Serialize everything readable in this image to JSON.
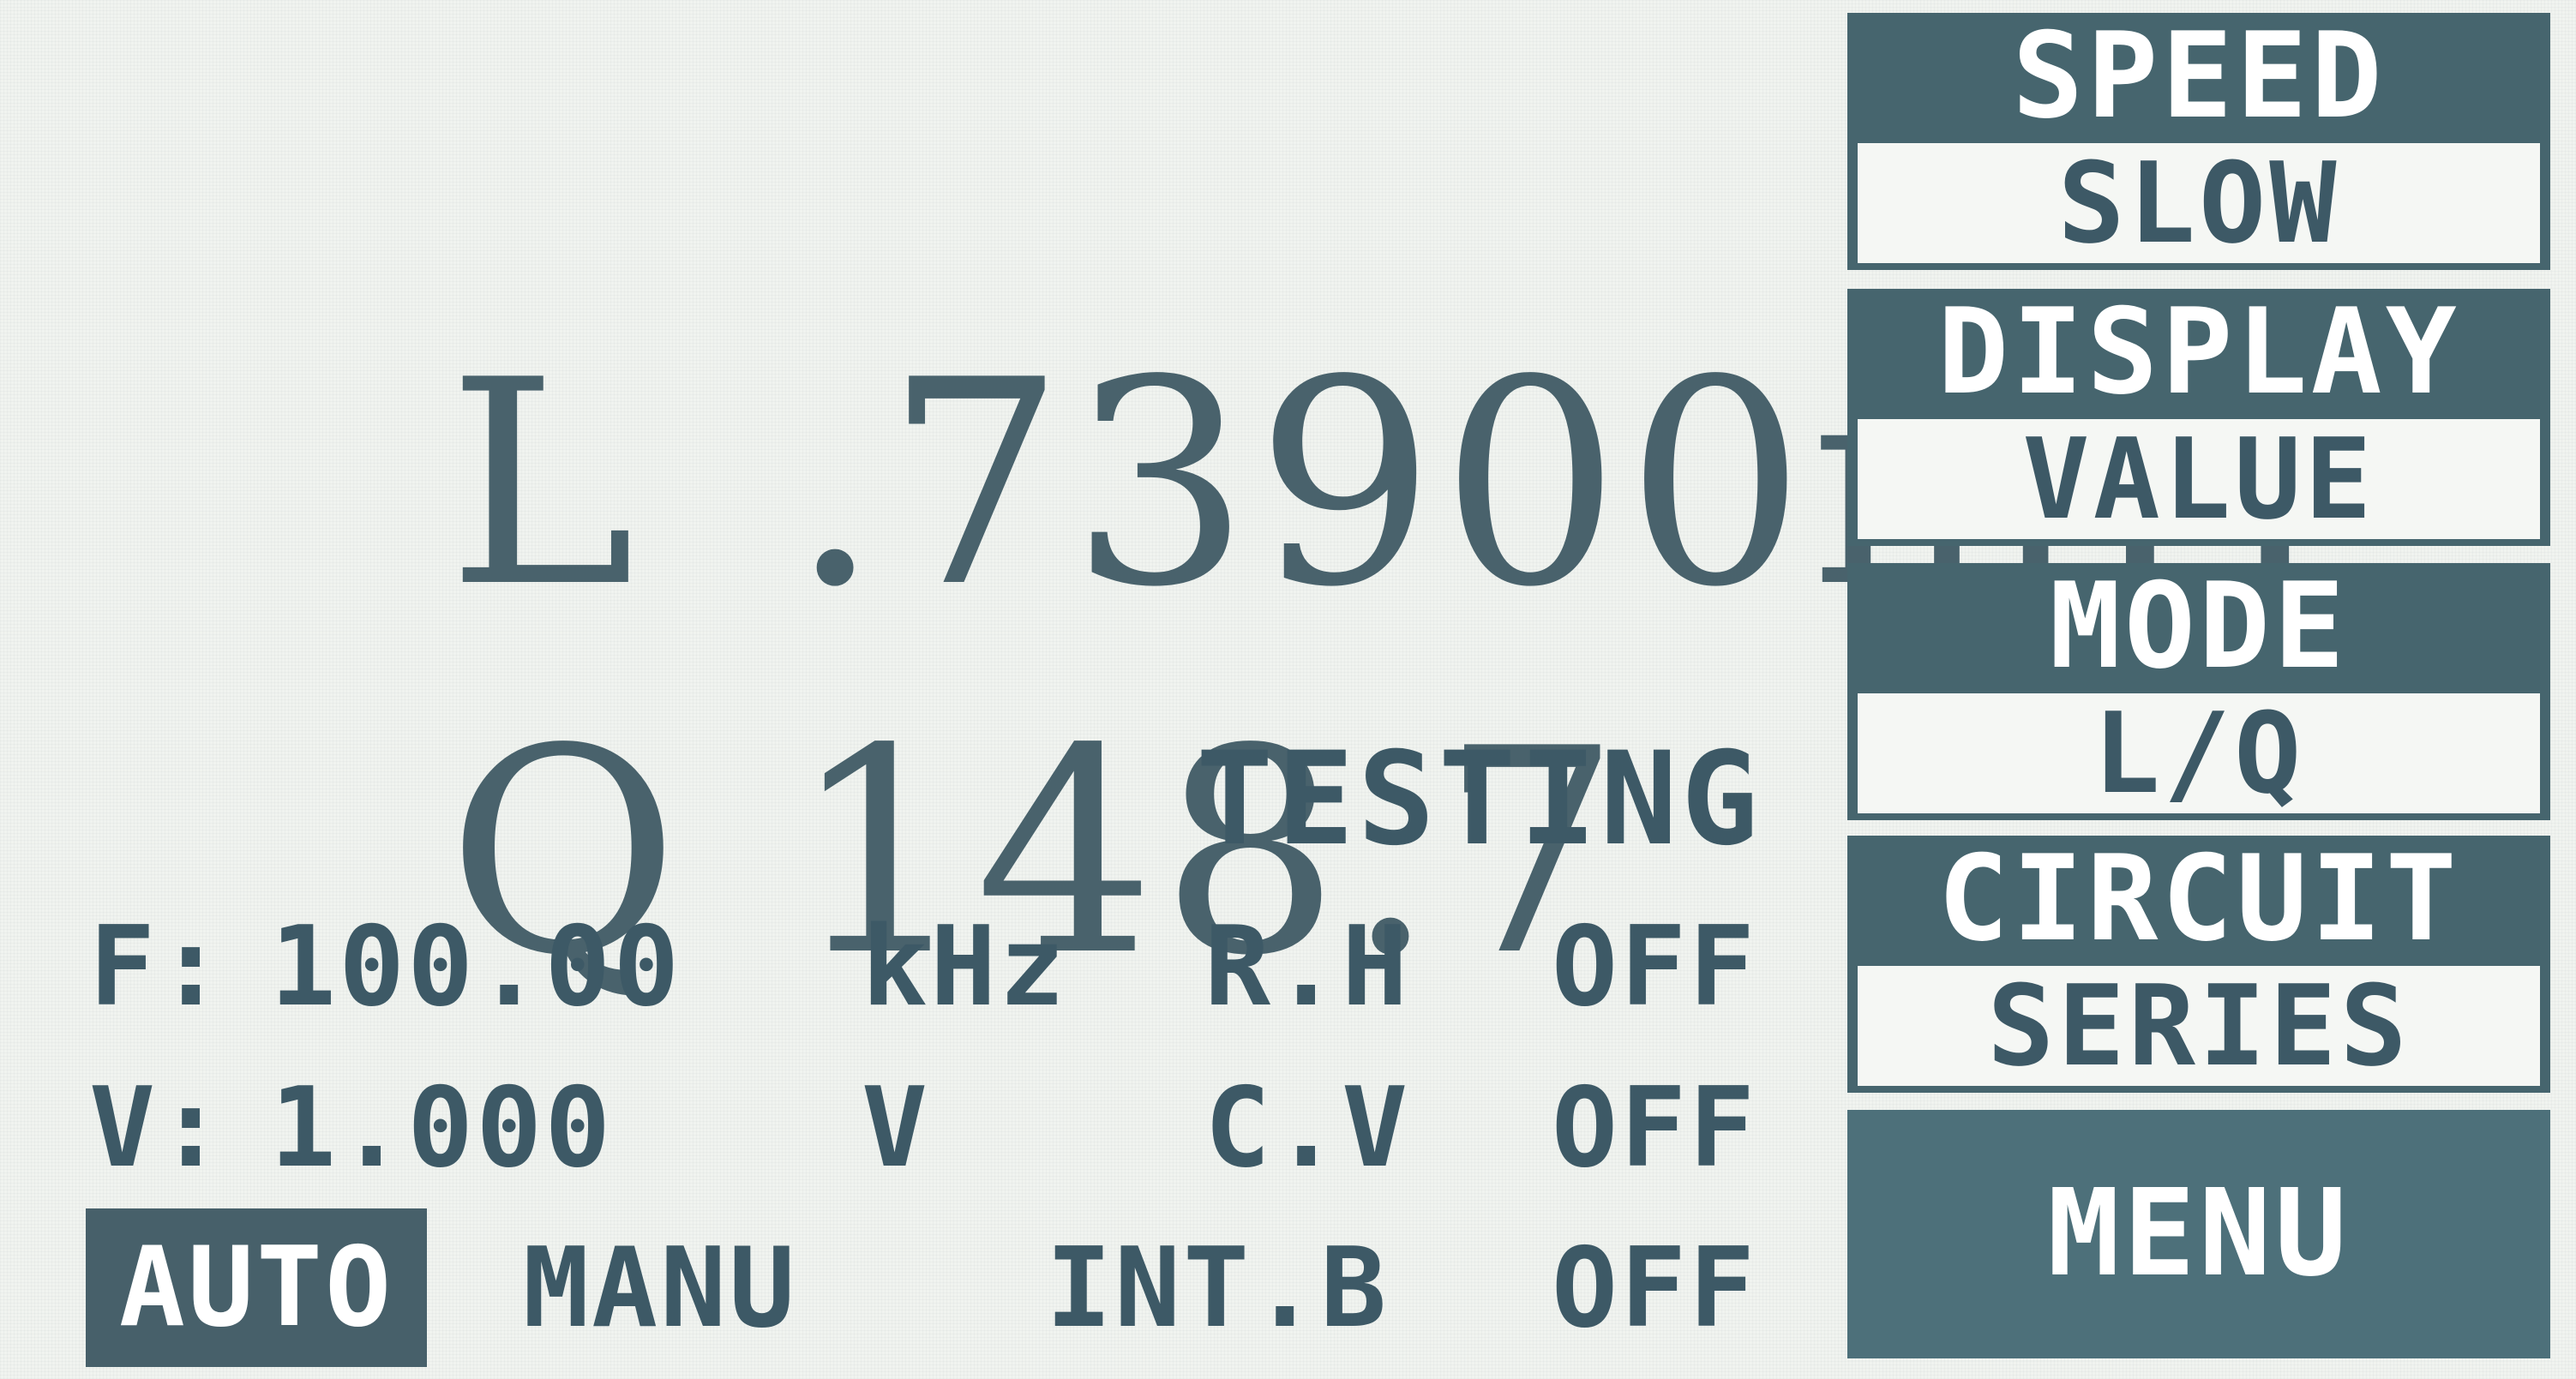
{
  "primary": {
    "label": "L",
    "value": ".73900",
    "unit": "mH"
  },
  "secondary": {
    "label": "Q",
    "value": "148.7"
  },
  "status": "TESTING",
  "parameters": {
    "frequency": {
      "label": "F:",
      "value": "100.00",
      "unit": "kHz"
    },
    "voltage": {
      "label": "V:",
      "value": "1.000",
      "unit": "V"
    },
    "rh": {
      "label": "R.H",
      "value": "OFF"
    },
    "cv": {
      "label": "C.V",
      "value": "OFF"
    },
    "intb": {
      "label": "INT.B",
      "value": "OFF"
    }
  },
  "range": {
    "auto_label": "AUTO",
    "manu_label": "MANU",
    "selected": "AUTO"
  },
  "softkeys": {
    "speed": {
      "title": "SPEED",
      "value": "SLOW"
    },
    "display": {
      "title": "DISPLAY",
      "value": "VALUE"
    },
    "mode": {
      "title": "MODE",
      "value": "L/Q"
    },
    "circuit": {
      "title": "CIRCUIT",
      "value": "SERIES"
    },
    "menu": {
      "title": "MENU"
    }
  },
  "colors": {
    "screen_bg": "#f0f3ef",
    "text": "#3d5966",
    "softkey_bg": "#46656e",
    "menu_bg": "#4d707a",
    "highlight_bg": "#47606a"
  }
}
